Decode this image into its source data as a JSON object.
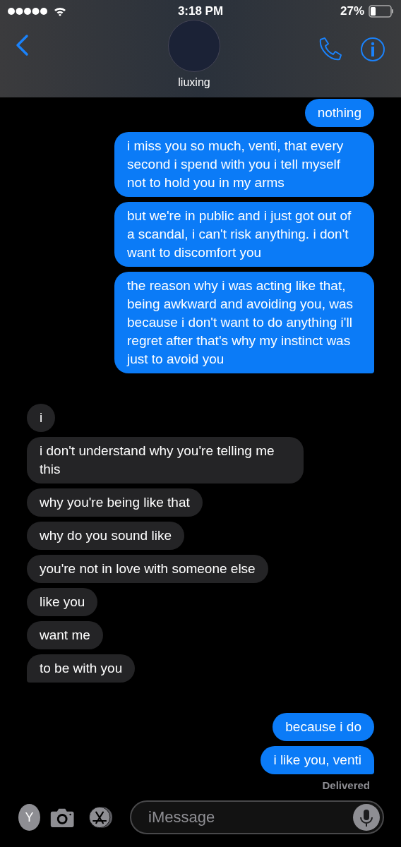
{
  "status_bar": {
    "time": "3:18 PM",
    "battery": "27%"
  },
  "header": {
    "contact_name": "liuxing"
  },
  "messages": [
    {
      "kind": "sent",
      "text": "nothing",
      "tail": false
    },
    {
      "kind": "sent",
      "text": "i miss you so much, venti, that every second i spend with you i tell myself not to hold you in my arms",
      "tail": false
    },
    {
      "kind": "sent",
      "text": "but we're in public and i just got out of a scandal, i can't risk anything. i don't want to discomfort you",
      "tail": false
    },
    {
      "kind": "sent",
      "text": "the reason why i was acting like that, being awkward and avoiding you, was because i don't want to do anything i'll regret after that's why my instinct was just to avoid you",
      "tail": true
    },
    {
      "kind": "received",
      "text": "i",
      "tail": false
    },
    {
      "kind": "received",
      "text": "i don't understand why you're telling me this",
      "tail": false
    },
    {
      "kind": "received",
      "text": "why you're being like that",
      "tail": false
    },
    {
      "kind": "received",
      "text": "why do you sound like",
      "tail": false
    },
    {
      "kind": "received",
      "text": "you're not in love with someone else",
      "tail": false
    },
    {
      "kind": "received",
      "text": "like you",
      "tail": false
    },
    {
      "kind": "received",
      "text": "want me",
      "tail": false
    },
    {
      "kind": "received",
      "text": "to be with you",
      "tail": true
    },
    {
      "kind": "sent",
      "text": "because i do",
      "tail": false
    },
    {
      "kind": "sent",
      "text": "i like you, venti",
      "tail": true
    }
  ],
  "delivery_status": "Delivered",
  "compose": {
    "avatar_letter": "Y",
    "placeholder": "iMessage"
  }
}
